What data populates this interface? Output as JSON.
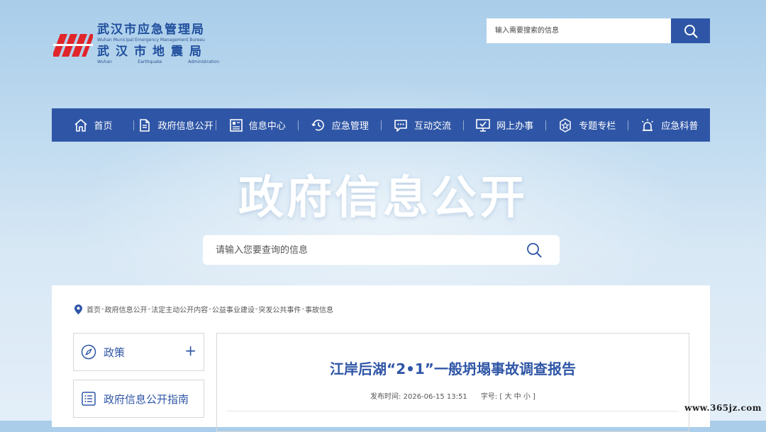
{
  "logo": {
    "cn_line1": "武汉市应急管理局",
    "en_line1": "Wuhan Municipal Emergency Management Bureau",
    "cn_line2": "武汉市地震局",
    "en_line2": [
      "Wuhan",
      "Earthquake",
      "Administration"
    ],
    "mark_color": "#e0252b"
  },
  "top_search": {
    "placeholder": "输入需要搜索的信息",
    "button_icon": "search-icon"
  },
  "nav": {
    "items": [
      {
        "label": "首页",
        "icon": "home-icon"
      },
      {
        "label": "政府信息公开",
        "icon": "document-icon"
      },
      {
        "label": "信息中心",
        "icon": "news-icon"
      },
      {
        "label": "应急管理",
        "icon": "clock-icon"
      },
      {
        "label": "互动交流",
        "icon": "chat-icon"
      },
      {
        "label": "网上办事",
        "icon": "monitor-icon"
      },
      {
        "label": "专题专栏",
        "icon": "badge-icon"
      },
      {
        "label": "应急科普",
        "icon": "alarm-light-icon"
      }
    ]
  },
  "hero": {
    "title": "政府信息公开",
    "search_placeholder": "请输入您要查询的信息"
  },
  "breadcrumb": [
    "首页",
    "政府信息公开",
    "法定主动公开内容",
    "公益事业建设",
    "突发公共事件",
    "事故信息"
  ],
  "breadcrumb_sep": "-",
  "sidebar": {
    "items": [
      {
        "label": "政策",
        "icon": "compass-icon",
        "expand": "+"
      },
      {
        "label": "政府信息公开指南",
        "icon": "list-icon"
      }
    ]
  },
  "article": {
    "title": "江岸后湖“2•1”一般坍塌事故调查报告",
    "publish_label": "发布时间:",
    "publish_time": "2026-06-15 13:51",
    "font_label": "字号:",
    "font_open": "[",
    "font_large": "大",
    "font_medium": "中",
    "font_small": "小",
    "font_close": "]"
  },
  "watermark": "www.365jz.com",
  "colors": {
    "primary": "#2f56a6",
    "logo_red": "#e0252b"
  }
}
